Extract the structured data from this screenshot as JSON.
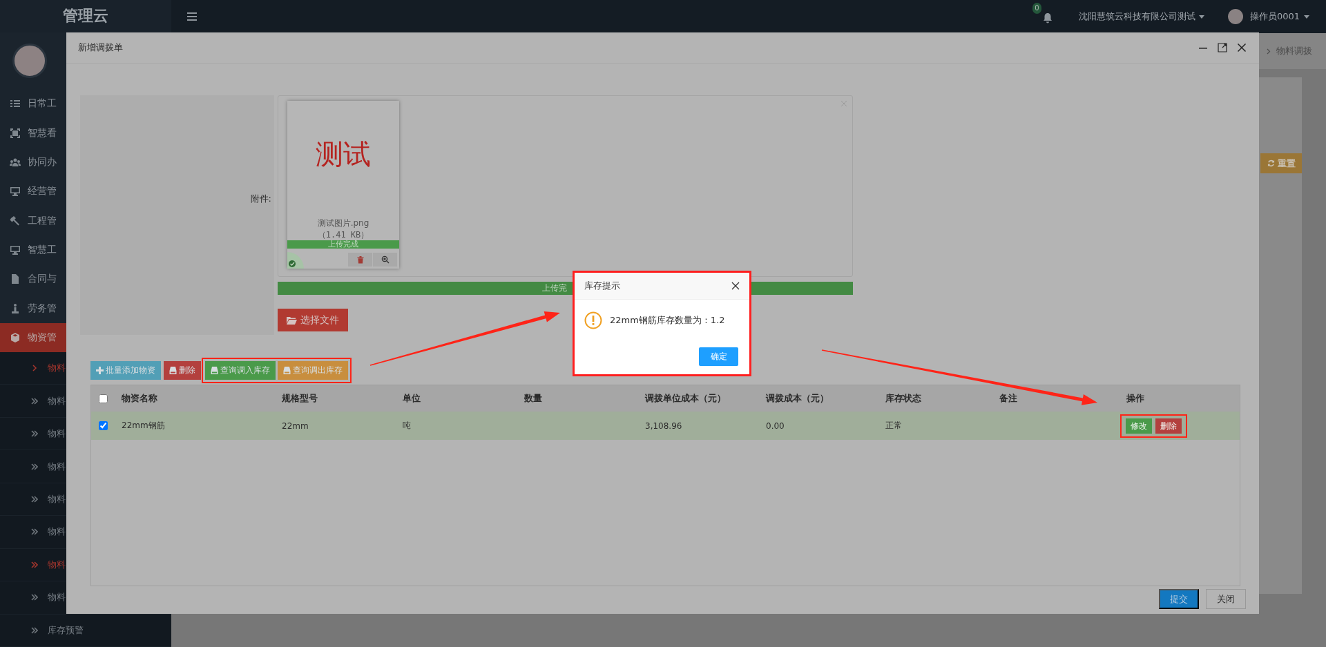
{
  "sidebar": {
    "logo": "管理云",
    "items": [
      {
        "label": "日常工",
        "selected": false
      },
      {
        "label": "智慧看",
        "selected": false
      },
      {
        "label": "协同办",
        "selected": false
      },
      {
        "label": "经营管",
        "selected": false
      },
      {
        "label": "工程管",
        "selected": false
      },
      {
        "label": "智慧工",
        "selected": false
      },
      {
        "label": "合同与",
        "selected": false
      },
      {
        "label": "劳务管",
        "selected": false
      },
      {
        "label": "物资管",
        "selected": true,
        "children": [
          {
            "label": "物料",
            "selected": true,
            "highlighted": false
          },
          {
            "label": "物料",
            "selected": false,
            "highlighted": false
          },
          {
            "label": "物料",
            "selected": false,
            "highlighted": false
          },
          {
            "label": "物料",
            "selected": false,
            "highlighted": false
          },
          {
            "label": "物料",
            "selected": false,
            "highlighted": false
          },
          {
            "label": "物料",
            "selected": false,
            "highlighted": false
          },
          {
            "label": "物料",
            "selected": false,
            "highlighted": true
          },
          {
            "label": "物料",
            "selected": false,
            "highlighted": false
          },
          {
            "label": "库存预警",
            "selected": false,
            "highlighted": false
          }
        ]
      }
    ]
  },
  "topbar": {
    "notification_count": "0",
    "company": "沈阳慧筑云科技有限公司测试",
    "user": "操作员0001"
  },
  "background": {
    "breadcrumb": "物料调拨",
    "reset_button": "重置"
  },
  "modal": {
    "title": "新增调拨单",
    "attachment": {
      "label": "附件:",
      "file": {
        "preview_text": "测试",
        "name": "测试图片.png",
        "size": "（1.41 KB）",
        "status": "上传完成",
        "uploaded": true
      },
      "progress": {
        "label": "上传完",
        "level": 1
      },
      "choose_button": "选择文件"
    },
    "toolbar": [
      {
        "highlighted": false,
        "buttons": [
          {
            "label": "批量添加物资",
            "kind": "info"
          },
          {
            "label": "删除",
            "kind": "danger"
          }
        ]
      },
      {
        "highlighted": true,
        "buttons": [
          {
            "label": "查询调入库存",
            "kind": "success"
          },
          {
            "label": "查询调出库存",
            "kind": "warning"
          }
        ]
      }
    ],
    "table": {
      "select_all_checked": false,
      "columns": [
        "物资名称",
        "规格型号",
        "单位",
        "数量",
        "调拨单位成本（元）",
        "调拨成本（元）",
        "库存状态",
        "备注",
        "操作"
      ],
      "rows": [
        {
          "checked": true,
          "selected": true,
          "cells": [
            "22mm钢筋",
            "22mm",
            "吨",
            null,
            "3,108.96",
            "0.00",
            "正常",
            null
          ],
          "actions_highlighted": true,
          "actions": [
            {
              "label": "修改",
              "kind": "success"
            },
            {
              "label": "删除",
              "kind": "danger"
            }
          ]
        }
      ]
    },
    "footer": [
      {
        "label": "提交",
        "kind": "primary"
      },
      {
        "label": "关闭",
        "kind": "default"
      }
    ]
  },
  "dialog": {
    "title": "库存提示",
    "message": "22mm钢筋库存数量为：1.2",
    "button": "确定",
    "highlighted": true
  }
}
